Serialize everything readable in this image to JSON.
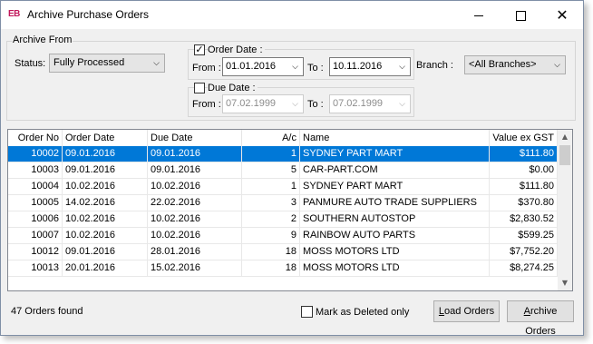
{
  "window": {
    "app_icon": "EB",
    "title": "Archive Purchase Orders",
    "minimize_icon": "minimize-icon",
    "maximize_icon": "maximize-icon",
    "close_icon": "close-icon"
  },
  "filters": {
    "group_label": "Archive From",
    "status_label": "Status:",
    "status_value": "Fully Processed",
    "order_date": {
      "checked": true,
      "label": "Order Date :",
      "from_label": "From :",
      "from_value": "01.01.2016",
      "to_label": "To :",
      "to_value": "10.11.2016"
    },
    "branch_label": "Branch :",
    "branch_value": "<All Branches>",
    "due_date": {
      "checked": false,
      "label": "Due Date :",
      "from_label": "From :",
      "from_value": "07.02.1999",
      "to_label": "To :",
      "to_value": "07.02.1999"
    }
  },
  "grid": {
    "columns": [
      "Order No",
      "Order Date",
      "Due Date",
      "A/c",
      "Name",
      "Value ex GST"
    ],
    "rows": [
      {
        "order_no": "10002",
        "order_date": "09.01.2016",
        "due_date": "09.01.2016",
        "ac": "1",
        "name": "SYDNEY PART MART",
        "value": "$111.80",
        "selected": true
      },
      {
        "order_no": "10003",
        "order_date": "09.01.2016",
        "due_date": "09.01.2016",
        "ac": "5",
        "name": "CAR-PART.COM",
        "value": "$0.00"
      },
      {
        "order_no": "10004",
        "order_date": "10.02.2016",
        "due_date": "10.02.2016",
        "ac": "1",
        "name": "SYDNEY PART MART",
        "value": "$111.80"
      },
      {
        "order_no": "10005",
        "order_date": "14.02.2016",
        "due_date": "22.02.2016",
        "ac": "3",
        "name": "PANMURE AUTO TRADE SUPPLIERS",
        "value": "$370.80"
      },
      {
        "order_no": "10006",
        "order_date": "10.02.2016",
        "due_date": "10.02.2016",
        "ac": "2",
        "name": "SOUTHERN AUTOSTOP",
        "value": "$2,830.52"
      },
      {
        "order_no": "10007",
        "order_date": "10.02.2016",
        "due_date": "10.02.2016",
        "ac": "9",
        "name": "RAINBOW AUTO PARTS",
        "value": "$599.25"
      },
      {
        "order_no": "10012",
        "order_date": "09.01.2016",
        "due_date": "28.01.2016",
        "ac": "18",
        "name": "MOSS MOTORS LTD",
        "value": "$7,752.20"
      },
      {
        "order_no": "10013",
        "order_date": "20.01.2016",
        "due_date": "15.02.2016",
        "ac": "18",
        "name": "MOSS MOTORS LTD",
        "value": "$8,274.25"
      }
    ]
  },
  "footer": {
    "count_text": "47 Orders found",
    "mark_deleted_label": "Mark as Deleted only",
    "mark_deleted_checked": false,
    "load_button": "Load Orders",
    "archive_button": "Archive Orders"
  },
  "colors": {
    "selection": "#0078d7",
    "app_icon": "#c2185b"
  }
}
